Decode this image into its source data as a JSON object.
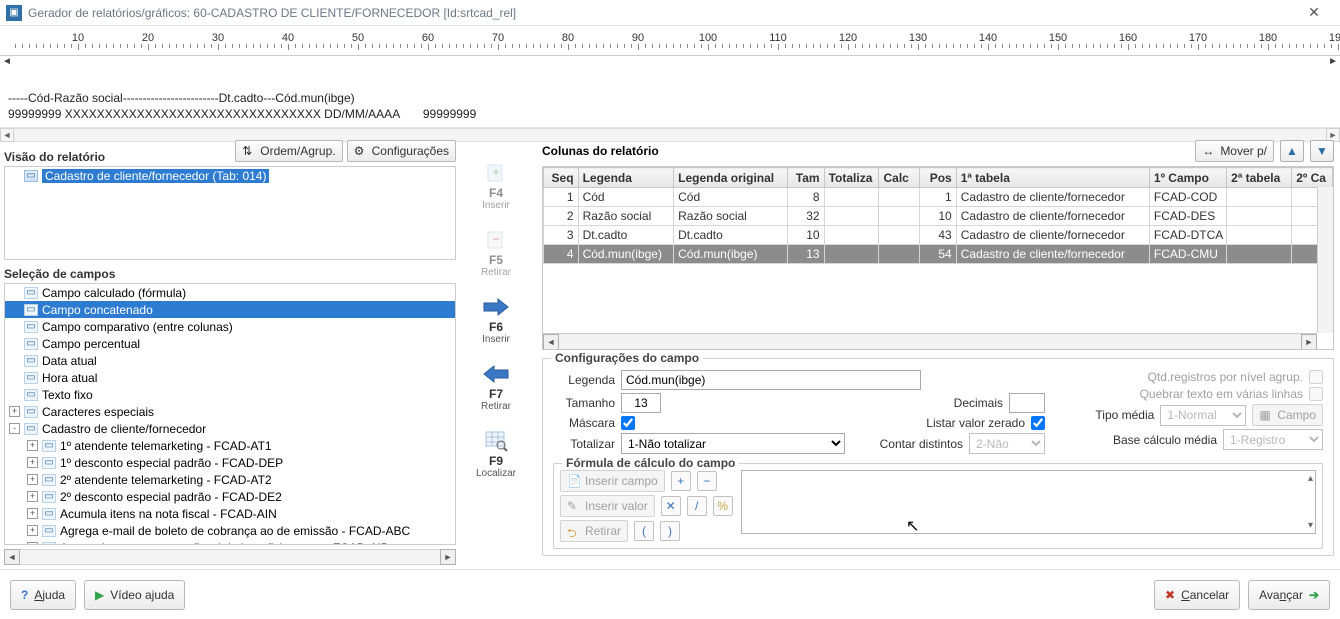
{
  "window": {
    "title": "Gerador de relatórios/gráficos: 60-CADASTRO DE CLIENTE/FORNECEDOR [Id:srtcad_rel]",
    "close_tooltip": "Fechar"
  },
  "ruler": {
    "labels": [
      "10",
      "20",
      "30",
      "40",
      "50",
      "60",
      "70",
      "80",
      "90",
      "100",
      "110",
      "120",
      "130",
      "140",
      "150",
      "160",
      "170",
      "180",
      "190"
    ]
  },
  "preview": {
    "line1": "-----Cód-Razão social------------------------Dt.cadto---Cód.mun(ibge)",
    "line2": "99999999 XXXXXXXXXXXXXXXXXXXXXXXXXXXXXXXX DD/MM/AAAA       99999999"
  },
  "left": {
    "visao_title": "Visão do relatório",
    "ordem_btn": "Ordem/Agrup.",
    "config_btn": "Configurações",
    "visao_root": "Cadastro de cliente/fornecedor (Tab: 014)",
    "selecao_title": "Seleção de campos",
    "campos": [
      "Campo calculado (fórmula)",
      "Campo concatenado",
      "Campo comparativo (entre colunas)",
      "Campo percentual",
      "Data atual",
      "Hora atual",
      "Texto fixo",
      "Caracteres especiais",
      "Cadastro de cliente/fornecedor",
      "1º atendente telemarketing - FCAD-AT1",
      "1º desconto especial padrão - FCAD-DEP",
      "2º atendente telemarketing - FCAD-AT2",
      "2º desconto especial padrão - FCAD-DE2",
      "Acumula itens na nota fiscal - FCAD-AIN",
      "Agrega e-mail de boleto de cobrança ao de emissão - FCAD-ABC",
      "Agrupa insumos na nota fiscal de beneficiamento - FCAD-AIB"
    ],
    "selected_index": 1
  },
  "actions": {
    "f4": {
      "k": "F4",
      "l": "Inserir"
    },
    "f5": {
      "k": "F5",
      "l": "Retirar"
    },
    "f6": {
      "k": "F6",
      "l": "Inserir"
    },
    "f7": {
      "k": "F7",
      "l": "Retirar"
    },
    "f9": {
      "k": "F9",
      "l": "Localizar"
    }
  },
  "right": {
    "title": "Colunas do relatório",
    "mover": "Mover p/",
    "headers": [
      "Seq",
      "Legenda",
      "Legenda original",
      "Tam",
      "Totaliza",
      "Calc",
      "Pos",
      "1ª tabela",
      "1º Campo",
      "2ª tabela",
      "2º Ca"
    ],
    "rows": [
      {
        "seq": "1",
        "legenda": "Cód",
        "orig": "Cód",
        "tam": "8",
        "tot": "",
        "calc": "",
        "pos": "1",
        "tab1": "Cadastro de cliente/fornecedor",
        "cmp1": "FCAD-COD"
      },
      {
        "seq": "2",
        "legenda": "Razão social",
        "orig": "Razão social",
        "tam": "32",
        "tot": "",
        "calc": "",
        "pos": "10",
        "tab1": "Cadastro de cliente/fornecedor",
        "cmp1": "FCAD-DES"
      },
      {
        "seq": "3",
        "legenda": "Dt.cadto",
        "orig": "Dt.cadto",
        "tam": "10",
        "tot": "",
        "calc": "",
        "pos": "43",
        "tab1": "Cadastro de cliente/fornecedor",
        "cmp1": "FCAD-DTCA"
      },
      {
        "seq": "4",
        "legenda": "Cód.mun(ibge)",
        "orig": "Cód.mun(ibge)",
        "tam": "13",
        "tot": "",
        "calc": "",
        "pos": "54",
        "tab1": "Cadastro de cliente/fornecedor",
        "cmp1": "FCAD-CMU"
      }
    ],
    "selected_row": 3
  },
  "config": {
    "titulo": "Configurações do campo",
    "legenda_label": "Legenda",
    "legenda_value": "Cód.mun(ibge)",
    "tamanho_label": "Tamanho",
    "tamanho_value": "13",
    "decimais_label": "Decimais",
    "decimais_value": "",
    "mascara_label": "Máscara",
    "listar_label": "Listar valor zerado",
    "totalizar_label": "Totalizar",
    "totalizar_value": "1-Não totalizar",
    "contar_label": "Contar distintos",
    "contar_value": "2-Não",
    "qtdreg_label": "Qtd.registros por nível agrup.",
    "quebrar_label": "Quebrar texto em várias linhas",
    "tipo_label": "Tipo média",
    "tipo_value": "1-Normal",
    "campo_btn": "Campo",
    "base_label": "Base cálculo média",
    "base_value": "1-Registro",
    "formula_titulo": "Fórmula de cálculo do campo",
    "inserir_campo": "Inserir campo",
    "inserir_valor": "Inserir valor",
    "retirar": "Retirar"
  },
  "footer": {
    "ajuda": "Ajuda",
    "video": "Vídeo ajuda",
    "cancelar": "Cancelar",
    "avancar": "Avançar"
  }
}
